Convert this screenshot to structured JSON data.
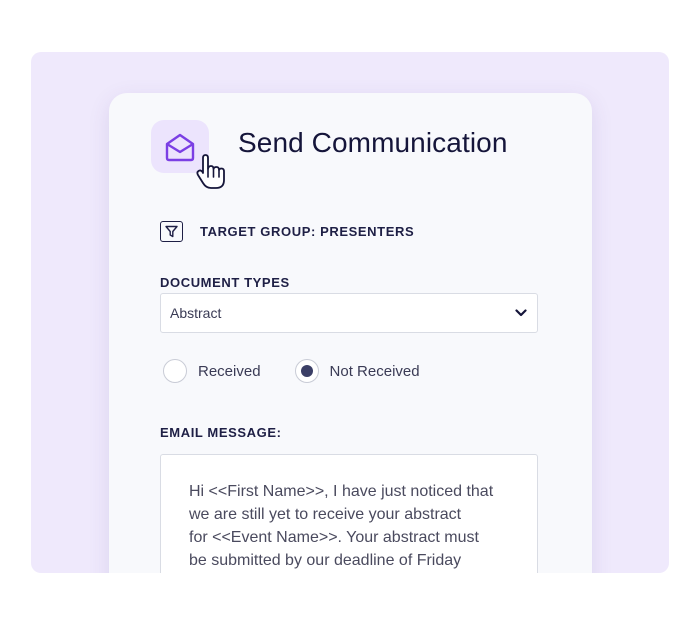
{
  "title": "Send Communication",
  "icons": {
    "header": "mail-open-icon",
    "cursor": "hand-pointer-icon",
    "target": "filter-icon",
    "select": "chevron-down-icon"
  },
  "colors": {
    "backdrop": "#efe9fc",
    "icon_tile": "#ece4fd",
    "icon_stroke": "#7b3fe4",
    "text_dark": "#15153a",
    "radio_selected": "#3b3f66"
  },
  "target_group": {
    "label": "TARGET GROUP: PRESENTERS"
  },
  "document_types": {
    "label": "DOCUMENT TYPES",
    "selected": "Abstract"
  },
  "status_options": [
    {
      "label": "Received",
      "selected": false
    },
    {
      "label": "Not Received",
      "selected": true
    }
  ],
  "email": {
    "label": "EMAIL MESSAGE:",
    "lines": [
      "Hi <<First Name>>, I have just noticed that",
      "we are still yet to receive your abstract",
      "for <<Event Name>>. Your abstract must",
      "be submitted by our deadline of Friday"
    ]
  }
}
